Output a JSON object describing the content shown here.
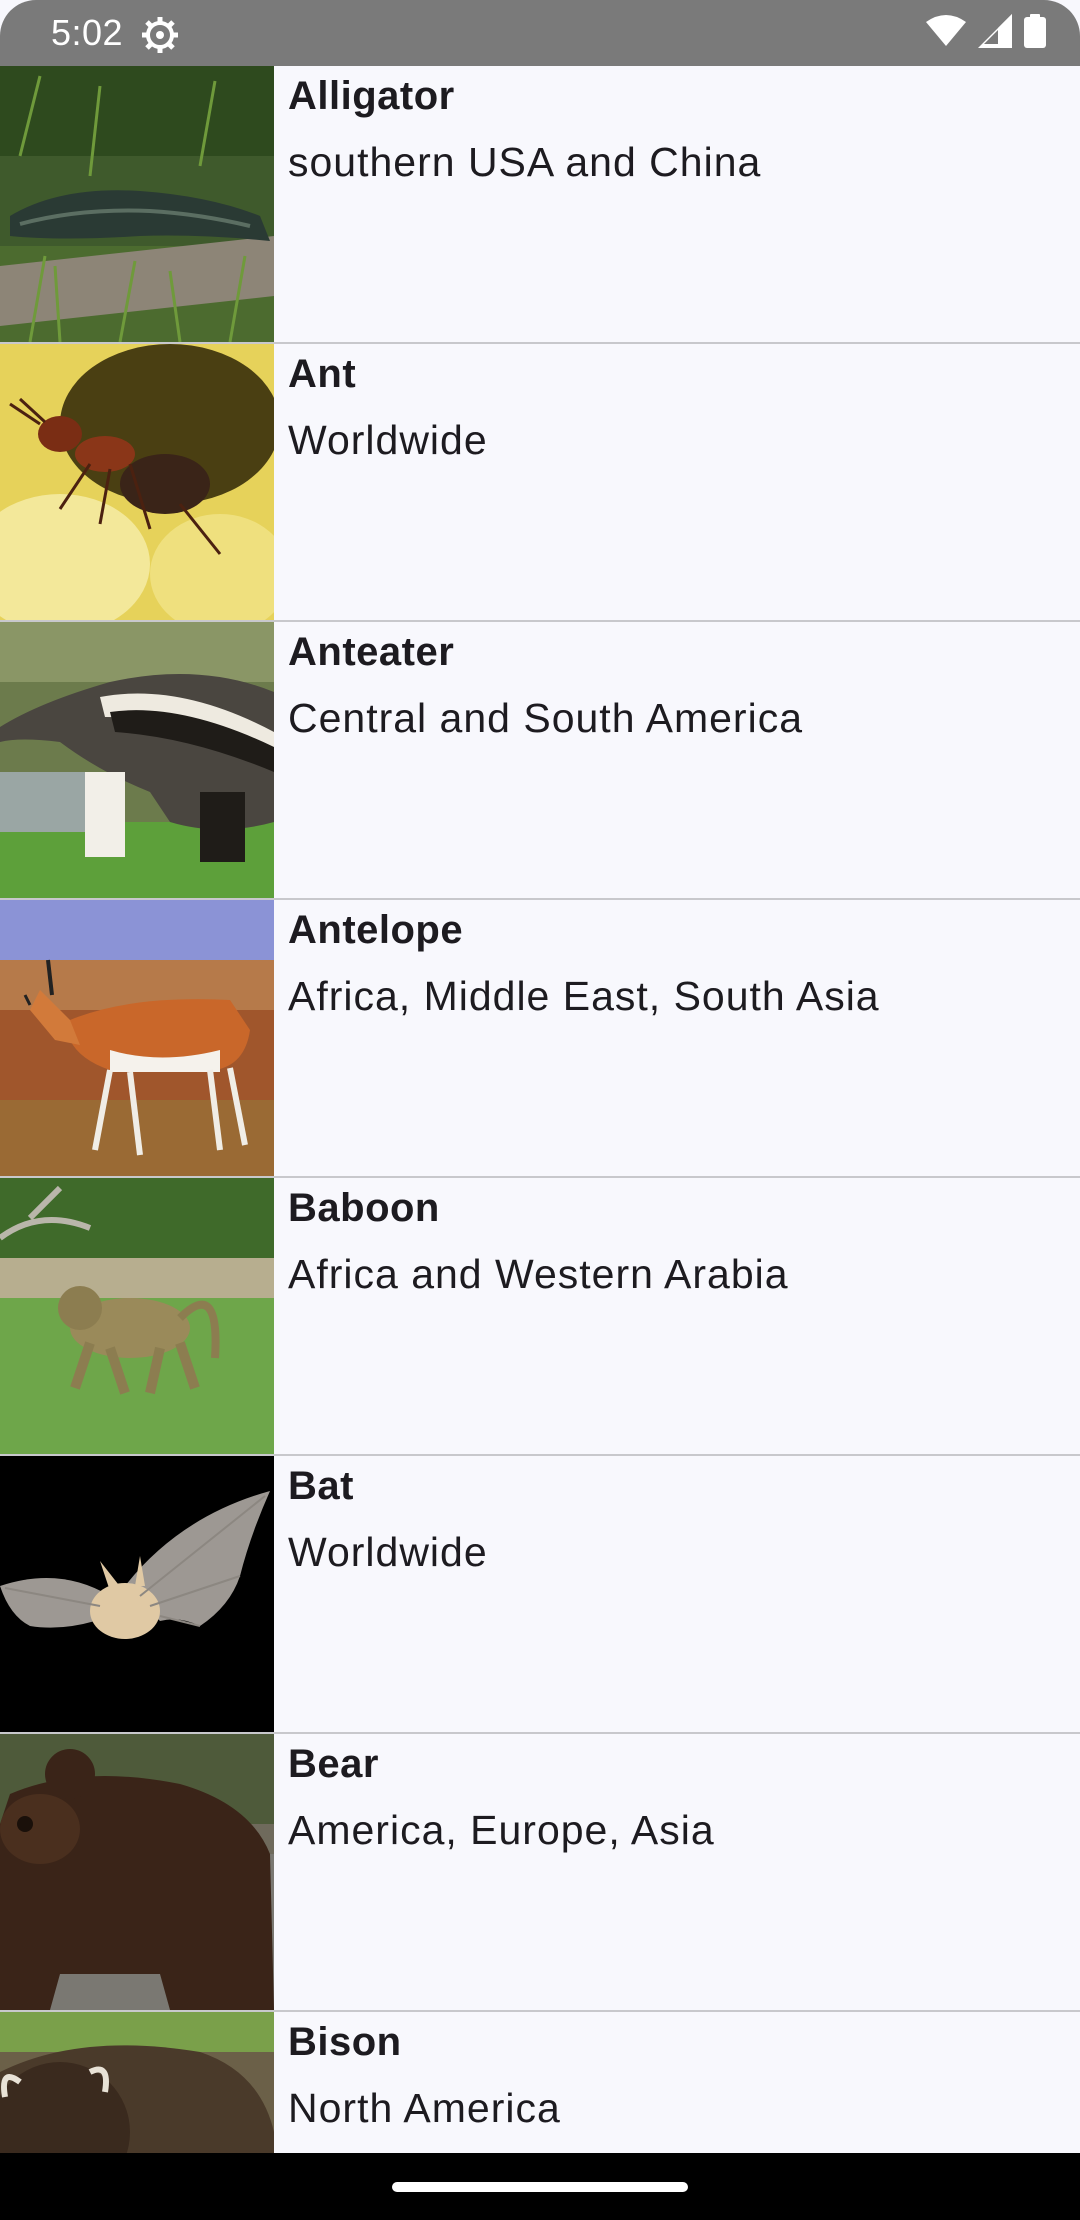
{
  "status_bar": {
    "time": "5:02",
    "icons": [
      "settings-gear-icon",
      "wifi-icon",
      "signal-icon",
      "battery-icon"
    ]
  },
  "animals": [
    {
      "name": "Alligator",
      "region": "southern USA and China",
      "image": "alligator-photo"
    },
    {
      "name": "Ant",
      "region": "Worldwide",
      "image": "ant-photo"
    },
    {
      "name": "Anteater",
      "region": "Central and South America",
      "image": "anteater-photo"
    },
    {
      "name": "Antelope",
      "region": "Africa, Middle East, South Asia",
      "image": "antelope-photo"
    },
    {
      "name": "Baboon",
      "region": "Africa and Western Arabia",
      "image": "baboon-photo"
    },
    {
      "name": "Bat",
      "region": "Worldwide",
      "image": "bat-photo"
    },
    {
      "name": "Bear",
      "region": "America, Europe, Asia",
      "image": "bear-photo"
    },
    {
      "name": "Bison",
      "region": "North America",
      "image": "bison-photo"
    }
  ],
  "colors": {
    "list_background": "#f8f8fd",
    "divider": "#c8c8cc",
    "status_bar": "#7a7a7a",
    "text": "#1d1b20"
  }
}
